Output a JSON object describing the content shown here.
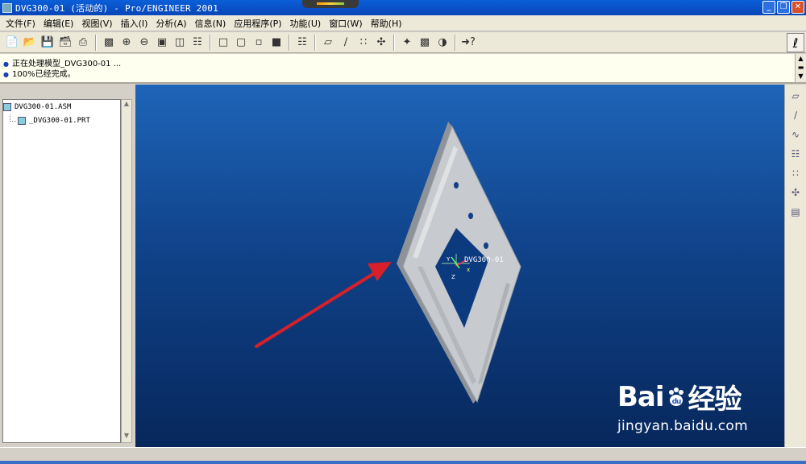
{
  "window": {
    "title": "DVG300-01 (活动的) - Pro/ENGINEER 2001",
    "minimize": "_",
    "restore": "❐",
    "close": "✕"
  },
  "menu": [
    "文件(F)",
    "编辑(E)",
    "视图(V)",
    "插入(I)",
    "分析(A)",
    "信息(N)",
    "应用程序(P)",
    "功能(U)",
    "窗口(W)",
    "帮助(H)"
  ],
  "toolbar": {
    "icons": [
      "new-file-icon",
      "open-folder-icon",
      "save-icon",
      "save-copy-icon",
      "print-icon",
      "repaint-icon",
      "zoom-in-icon",
      "zoom-out-icon",
      "zoom-fit-icon",
      "orient-icon",
      "saved-views-icon",
      "wireframe-icon",
      "hidden-line-icon",
      "no-hidden-icon",
      "shading-icon",
      "model-tree-icon",
      "datum-plane-icon",
      "datum-axis-icon",
      "datum-point-icon",
      "coordinate-system-icon",
      "spin-center-icon",
      "view-manager-icon",
      "layers-icon",
      "whats-this-icon"
    ],
    "right_button": "ℓ"
  },
  "messages": [
    "正在处理模型_DVG300-01 ...",
    "100%已经完成。"
  ],
  "model_tree": {
    "items": [
      {
        "label": "DVG300-01.ASM",
        "level": 0
      },
      {
        "label": "_DVG300-01.PRT",
        "level": 1
      }
    ]
  },
  "viewport": {
    "model_label": "DVG300-01",
    "csys_x": "x",
    "csys_y": "Y",
    "csys_z": "Z"
  },
  "right_toolbar": [
    "datum-plane-icon",
    "datum-axis-icon",
    "datum-curve-icon",
    "datum-point-icon",
    "offset-point-icon",
    "field-point-icon",
    "coordinate-system-icon"
  ],
  "watermark": {
    "brand_left": "Bai",
    "brand_right": "经验",
    "url": "jingyan.baidu.com"
  },
  "colors": {
    "viewport_top": "#1e64b8",
    "viewport_bottom": "#07275c",
    "arrow": "#d8202a",
    "title_bar": "#0a5fd8"
  }
}
